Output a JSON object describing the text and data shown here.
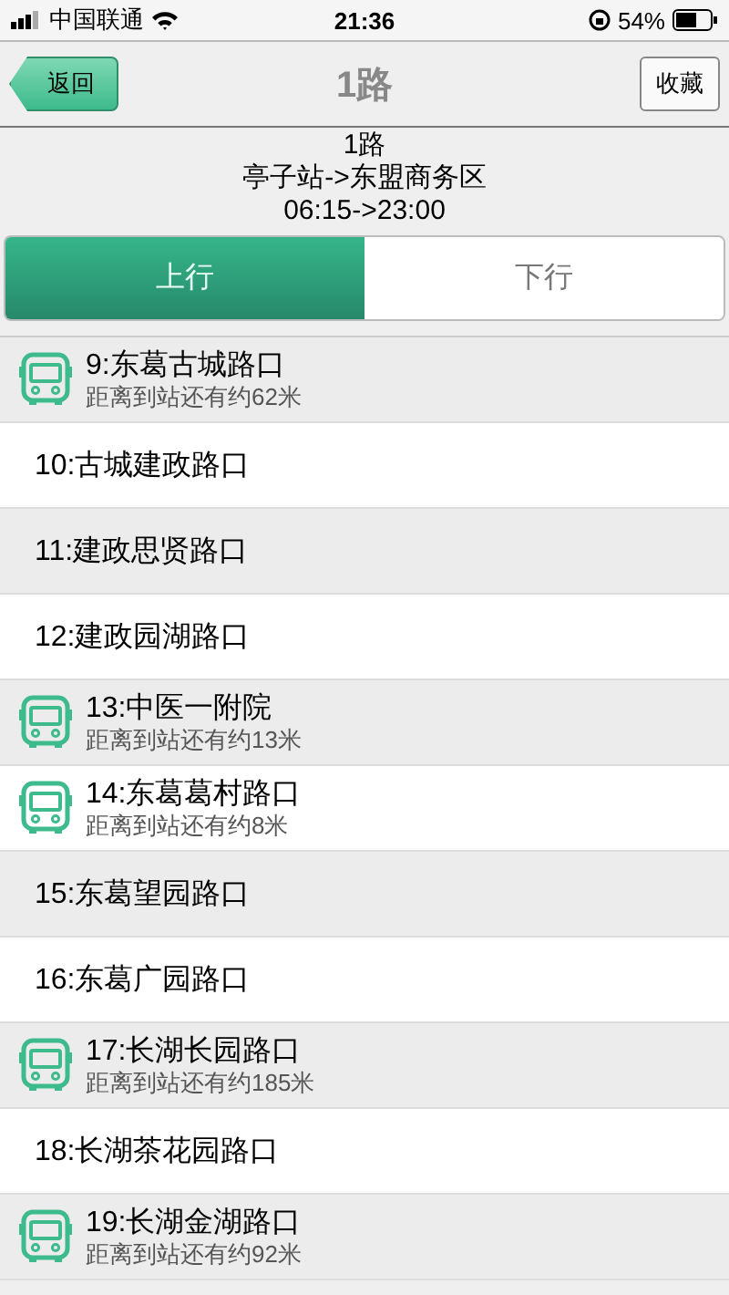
{
  "status_bar": {
    "carrier": "中国联通",
    "time": "21:36",
    "battery": "54%"
  },
  "nav": {
    "back": "返回",
    "title": "1路",
    "favorite": "收藏"
  },
  "route": {
    "name": "1路",
    "direction": "亭子站->东盟商务区",
    "hours": "06:15->23:00"
  },
  "tabs": [
    {
      "label": "上行",
      "selected": true
    },
    {
      "label": "下行",
      "selected": false
    }
  ],
  "stops": [
    {
      "kind": "bus",
      "name": "9:东葛古城路口",
      "distance": "距离到站还有约62米"
    },
    {
      "kind": "stop",
      "name": "10:古城建政路口"
    },
    {
      "kind": "stop",
      "name": "11:建政思贤路口"
    },
    {
      "kind": "stop",
      "name": "12:建政园湖路口"
    },
    {
      "kind": "bus",
      "name": "13:中医一附院",
      "distance": "距离到站还有约13米"
    },
    {
      "kind": "bus",
      "name": "14:东葛葛村路口",
      "distance": "距离到站还有约8米"
    },
    {
      "kind": "stop",
      "name": "15:东葛望园路口"
    },
    {
      "kind": "stop",
      "name": "16:东葛广园路口"
    },
    {
      "kind": "bus",
      "name": "17:长湖长园路口",
      "distance": "距离到站还有约185米"
    },
    {
      "kind": "stop",
      "name": "18:长湖茶花园路口"
    },
    {
      "kind": "bus",
      "name": "19:长湖金湖路口",
      "distance": "距离到站还有约92米"
    }
  ]
}
